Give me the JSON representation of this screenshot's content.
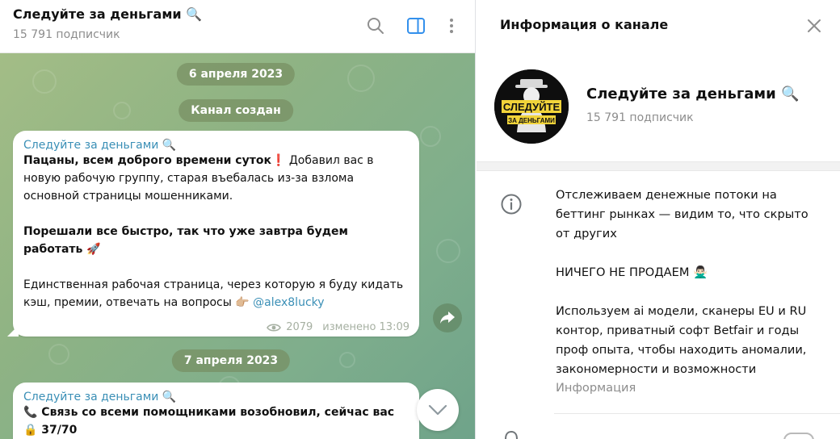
{
  "chat": {
    "title": "Следуйте за деньгами 🔍",
    "subtitle": "15 791 подписчик"
  },
  "dates": [
    "6 апреля 2023",
    "7 апреля 2023"
  ],
  "service_message": "Канал создан",
  "messages": [
    {
      "author": "Следуйте за деньгами 🔍",
      "bold_1": "Пацаны, всем доброго времени суток❗️",
      "text_1": " Добавил вас в новую рабочую группу, старая въебалась из-за взлома основной страницы мошенниками.",
      "bold_2": "Порешали все быстро, так что уже завтра будем работать 🚀",
      "text_2": "Единственная рабочая страница, через которую я буду кидать кэш, премии, отвечать на вопросы 👉🏼 ",
      "link": "@alex8lucky",
      "views": "2079",
      "edited": "изменено 13:09"
    },
    {
      "author": "Следуйте за деньгами 🔍",
      "bold_1": "📞 Связь со всеми помощниками возобновил, сейчас вас",
      "bold_2": "🔒 37/70"
    }
  ],
  "info": {
    "title": "Информация о канале",
    "channel_name": "Следуйте за деньгами 🔍",
    "subscribers": "15 791 подписчик",
    "avatar_text_top": "СЛЕДУЙТЕ",
    "avatar_text_bottom": "ЗА ДЕНЬГАМИ",
    "description": [
      "Отслеживаем денежные потоки на беттинг рынках — видим то, что скрыто от других",
      "НИЧЕГО НЕ ПРОДАЕМ 🙅🏻‍♂️",
      "Используем ai модели, сканеры EU и RU контор, приватный софт Betfair и годы проф опыта, чтобы находить аномалии, закономерности и возможности"
    ],
    "description_label": "Информация"
  },
  "colors": {
    "accent": "#3a8fb6",
    "sidebar_icon": "#3390ec",
    "avatar_yellow": "#f2d43a"
  }
}
